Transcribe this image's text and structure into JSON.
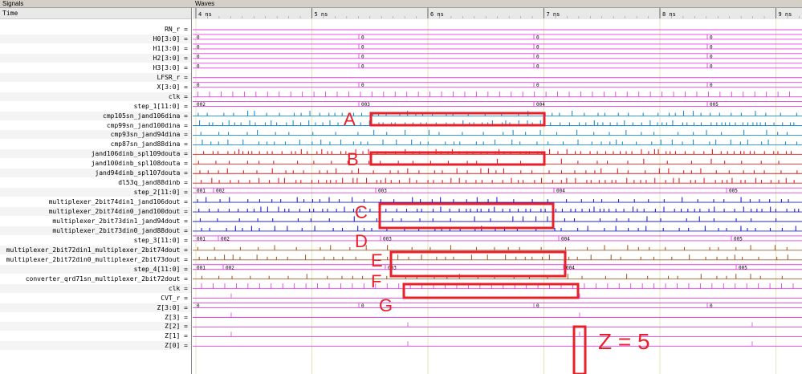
{
  "panes": {
    "signals_title": "Signals",
    "waves_title": "Waves",
    "time_label": "Time"
  },
  "time_ticks": [
    "4 ns",
    "5 ns",
    "6 ns",
    "7 ns",
    "8 ns",
    "9 ns"
  ],
  "signals": [
    {
      "name": "RN_r =",
      "type": "flat",
      "color": "#e040e0"
    },
    {
      "name": "H0[3:0] =",
      "type": "bus",
      "color": "#e040e0",
      "values": [
        "0",
        "0",
        "0",
        "0"
      ]
    },
    {
      "name": "H1[3:0] =",
      "type": "bus",
      "color": "#e040e0",
      "values": [
        "0",
        "0",
        "0",
        "0"
      ]
    },
    {
      "name": "H2[3:0] =",
      "type": "bus",
      "color": "#e040e0",
      "values": [
        "0",
        "0",
        "0",
        "0"
      ]
    },
    {
      "name": "H3[3:0] =",
      "type": "bus",
      "color": "#e040e0",
      "values": [
        "0",
        "0",
        "0",
        "0"
      ]
    },
    {
      "name": "LFSR_r =",
      "type": "flat",
      "color": "#e040e0"
    },
    {
      "name": "X[3:0] =",
      "type": "bus",
      "color": "#e040e0",
      "values": [
        "0",
        "0",
        "0",
        "0"
      ]
    },
    {
      "name": "clk =",
      "type": "pulse",
      "color": "#e040e0"
    },
    {
      "name": "step_1[11:0] =",
      "type": "bus",
      "color": "#e040e0",
      "values": [
        "002",
        "003",
        "004",
        "005"
      ]
    },
    {
      "name": "cmp105sn_jand106dina =",
      "type": "pulse",
      "color": "#1a8fd8"
    },
    {
      "name": "cmp99sn_jand100dina =",
      "type": "pulse",
      "color": "#1a8fd8"
    },
    {
      "name": "cmp93sn_jand94dina =",
      "type": "pulse",
      "color": "#1a8fd8"
    },
    {
      "name": "cmp87sn_jand88dina =",
      "type": "pulse",
      "color": "#1a8fd8"
    },
    {
      "name": "jand106dinb_spl109douta =",
      "type": "pulse",
      "color": "#e02020"
    },
    {
      "name": "jand100dinb_spl108douta =",
      "type": "pulse",
      "color": "#e02020"
    },
    {
      "name": "jand94dinb_spl107douta =",
      "type": "pulse",
      "color": "#e02020"
    },
    {
      "name": "dl53q_jand88dinb =",
      "type": "pulse",
      "color": "#e02020"
    },
    {
      "name": "step_2[11:0] =",
      "type": "bus",
      "color": "#e040e0",
      "values": [
        "001",
        "002",
        "003",
        "004",
        "005"
      ]
    },
    {
      "name": "multiplexer_2bit74din1_jand106dout =",
      "type": "pulse",
      "color": "#2020d0"
    },
    {
      "name": "multiplexer_2bit74din0_jand100dout =",
      "type": "pulse",
      "color": "#2020d0"
    },
    {
      "name": "multiplexer_2bit73din1_jand94dout =",
      "type": "pulse",
      "color": "#2020d0"
    },
    {
      "name": "multiplexer_2bit73din0_jand88dout =",
      "type": "pulse",
      "color": "#2020d0"
    },
    {
      "name": "step_3[11:0] =",
      "type": "bus",
      "color": "#e040e0",
      "values": [
        "001",
        "002",
        "003",
        "004",
        "005"
      ]
    },
    {
      "name": "multiplexer_2bit72din1_multiplexer_2bit74dout =",
      "type": "pulse",
      "color": "#a06030"
    },
    {
      "name": "multiplexer_2bit72din0_multiplexer_2bit73dout =",
      "type": "pulse",
      "color": "#a06030"
    },
    {
      "name": "step_4[11:0] =",
      "type": "bus",
      "color": "#e040e0",
      "values": [
        "001",
        "002",
        "003",
        "004",
        "005"
      ]
    },
    {
      "name": "converter_qrd71sn_multiplexer_2bit72dout =",
      "type": "pulse",
      "color": "#a06030"
    },
    {
      "name": "clk =",
      "type": "pulse",
      "color": "#e040e0"
    },
    {
      "name": "CVT_r =",
      "type": "flat",
      "color": "#e040e0"
    },
    {
      "name": "Z[3:0] =",
      "type": "bus",
      "color": "#e040e0",
      "values": [
        "0",
        "0",
        "0",
        "0"
      ]
    },
    {
      "name": "Z[3] =",
      "type": "flat",
      "color": "#e040e0"
    },
    {
      "name": "Z[2] =",
      "type": "flat",
      "color": "#e040e0"
    },
    {
      "name": "Z[1] =",
      "type": "flat",
      "color": "#e040e0"
    },
    {
      "name": "Z[0] =",
      "type": "flat",
      "color": "#e040e0"
    }
  ],
  "annotations": [
    {
      "label": "A",
      "color": "#e8202a"
    },
    {
      "label": "B",
      "color": "#e8202a"
    },
    {
      "label": "C",
      "color": "#e8202a"
    },
    {
      "label": "D",
      "color": "#e8202a"
    },
    {
      "label": "E",
      "color": "#e8202a"
    },
    {
      "label": "F",
      "color": "#e8202a"
    },
    {
      "label": "G",
      "color": "#e8202a"
    },
    {
      "label": "Z = 5",
      "color": "#e8202a"
    }
  ]
}
